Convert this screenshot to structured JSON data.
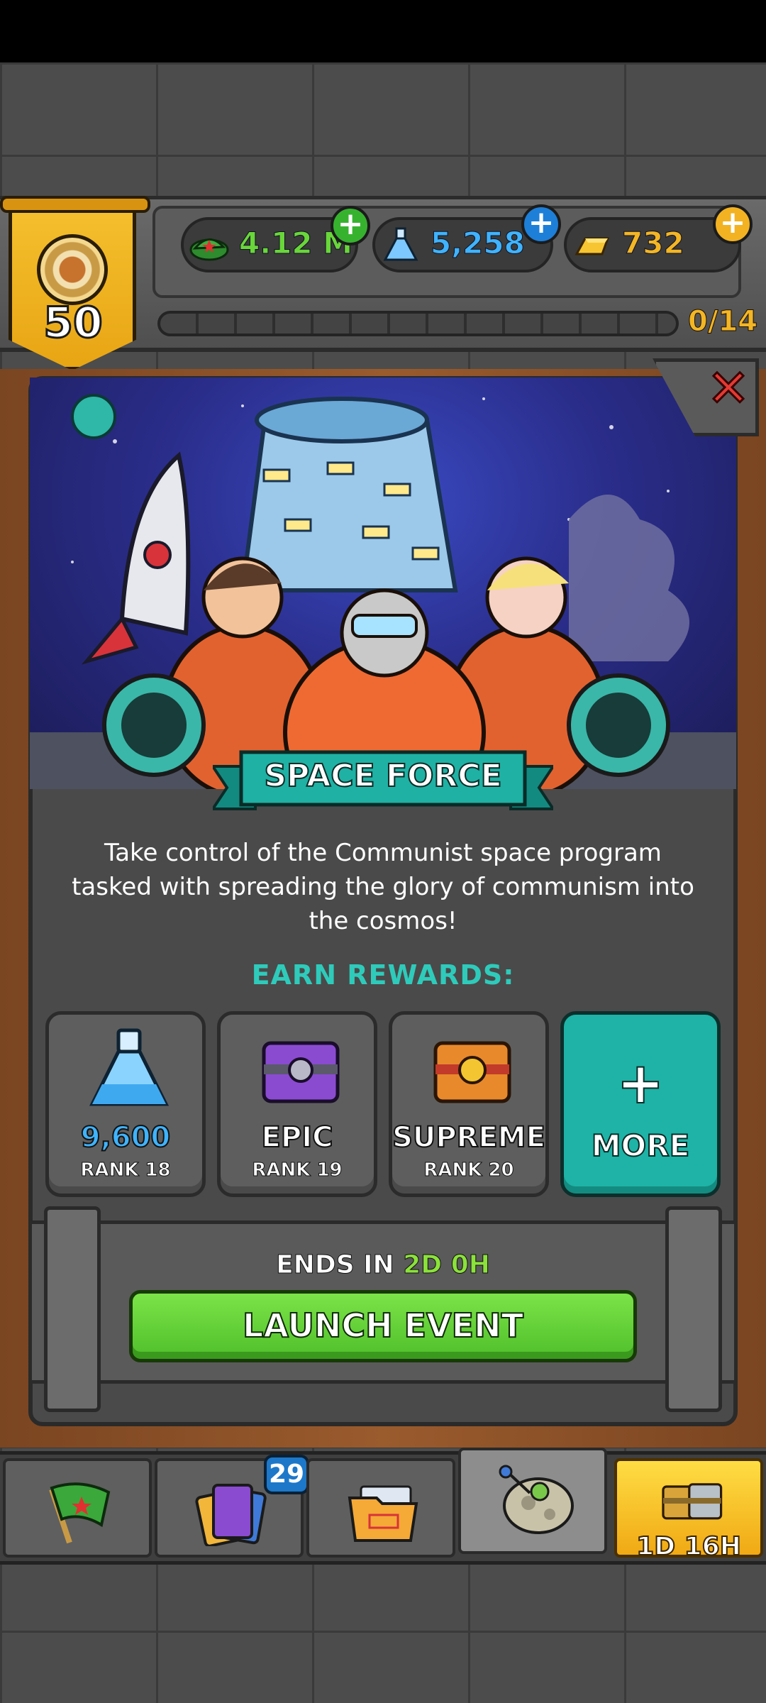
{
  "player": {
    "rank_level": "50"
  },
  "resources": {
    "cash": {
      "value": "4.12 M",
      "icon": "cap-icon"
    },
    "science": {
      "value": "5,258",
      "icon": "flask-icon"
    },
    "gold": {
      "value": "732",
      "icon": "gold-bar-icon"
    }
  },
  "progress": {
    "label": "0/14",
    "fraction": 0
  },
  "event": {
    "title": "SPACE FORCE",
    "description_lines": [
      "Take control of the Communist space program",
      "tasked with spreading the glory of communism into",
      "the cosmos!"
    ],
    "earn_label": "EARN REWARDS:",
    "rewards": [
      {
        "value": "9,600",
        "rank": "RANK 18",
        "icon": "flask-icon"
      },
      {
        "value": "EPIC",
        "rank": "RANK 19",
        "icon": "epic-crate-icon"
      },
      {
        "value": "SUPREME",
        "rank": "RANK 20",
        "icon": "supreme-crate-icon"
      }
    ],
    "more": {
      "plus": "+",
      "label": "MORE"
    },
    "ends_prefix": "ENDS IN",
    "ends_time": "2D 0H",
    "launch_label": "LAUNCH EVENT"
  },
  "close": {
    "glyph": "✕"
  },
  "nav": {
    "tabs": [
      {
        "name": "flag",
        "icon": "flag-icon"
      },
      {
        "name": "cards",
        "icon": "cards-icon",
        "badge": "29"
      },
      {
        "name": "files",
        "icon": "folder-icon"
      },
      {
        "name": "space",
        "icon": "asteroid-icon"
      },
      {
        "name": "crates",
        "icon": "crates-icon",
        "timer": "1D 16H"
      }
    ]
  },
  "colors": {
    "accent_teal": "#1eb3a6",
    "launch_green": "#5fd232",
    "rank_gold": "#f3b624",
    "close_red": "#e33b34"
  }
}
